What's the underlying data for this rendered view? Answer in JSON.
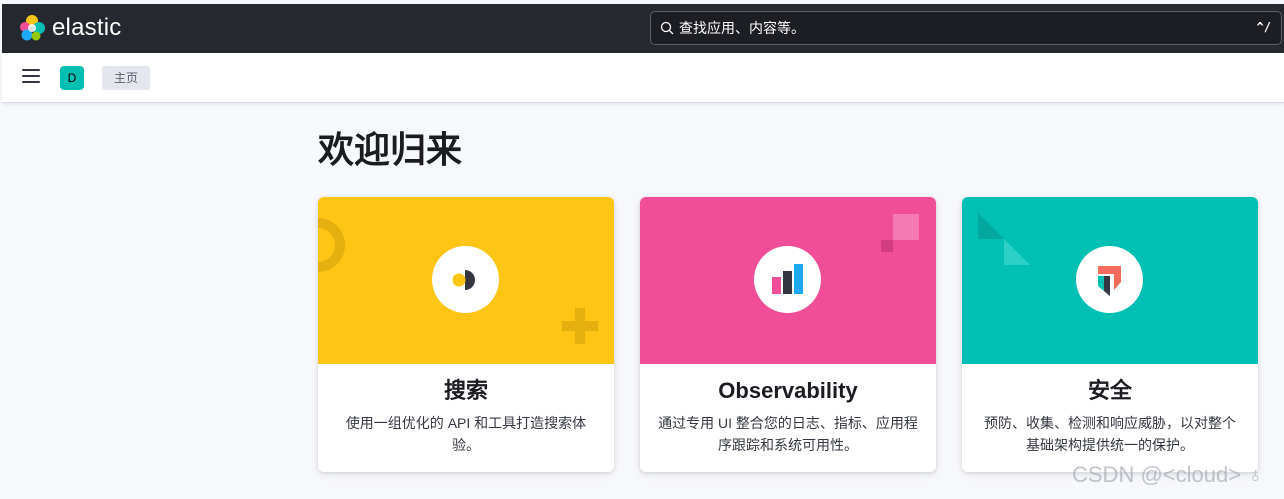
{
  "header": {
    "brand": "elastic",
    "search": {
      "placeholder": "查找应用、内容等。",
      "shortcut": "^/"
    }
  },
  "nav": {
    "space_initial": "D",
    "breadcrumb": "主页"
  },
  "main": {
    "title": "欢迎归来",
    "cards": [
      {
        "title": "搜索",
        "description": "使用一组优化的 API 和工具打造搜索体验。",
        "color": "#fec514"
      },
      {
        "title": "Observability",
        "description": "通过专用 UI 整合您的日志、指标、应用程序跟踪和系统可用性。",
        "color": "#f04e98"
      },
      {
        "title": "安全",
        "description": "预防、收集、检测和响应威胁，以对整个基础架构提供统一的保护。",
        "color": "#00bfb3"
      }
    ]
  },
  "watermark": "CSDN @<cloud> ♁"
}
